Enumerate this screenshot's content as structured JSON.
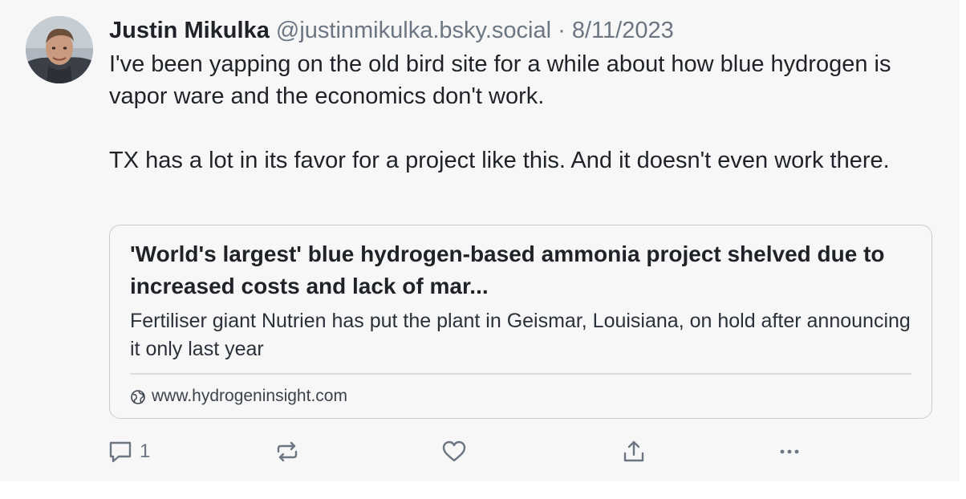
{
  "post": {
    "author": {
      "name": "Justin Mikulka",
      "handle": "@justinmikulka.bsky.social"
    },
    "separator": "·",
    "date": "8/11/2023",
    "text": {
      "paragraph1": "I've been yapping on the old bird site for a while about how blue hydrogen is vapor ware and the economics don't work.",
      "paragraph2": "TX has a lot in its favor for a project like this. And it doesn't even work there."
    },
    "embed": {
      "title": "'World's largest' blue hydrogen-based ammonia project shelved due to increased costs and lack of mar...",
      "description": "Fertiliser giant Nutrien has put the plant in Geismar, Louisiana, on hold after announcing it only last year",
      "domain": "www.hydrogeninsight.com",
      "domain_icon": "globe-icon"
    },
    "actions": {
      "reply_icon": "reply-icon",
      "reply_count": "1",
      "repost_icon": "repost-icon",
      "like_icon": "heart-icon",
      "share_icon": "share-icon",
      "more_icon": "more-icon"
    }
  },
  "colors": {
    "text": "#1f2328",
    "muted": "#6b7682",
    "background": "#f7f7f8",
    "border": "#c4cbd3"
  }
}
